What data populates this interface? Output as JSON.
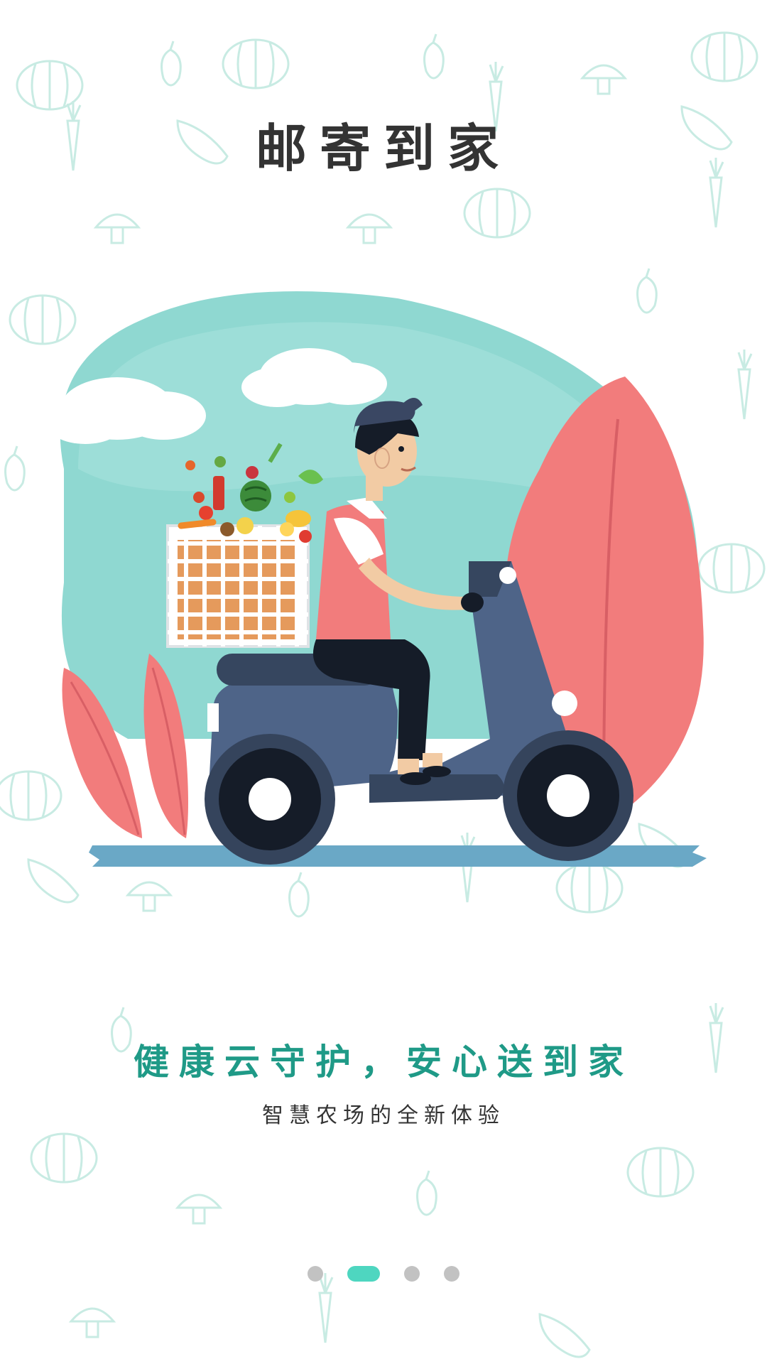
{
  "page": {
    "title": "邮寄到家",
    "slogan": "健康云守护，安心送到家",
    "subtitle": "智慧农场的全新体验"
  },
  "illustration": {
    "icon": "delivery-scooter-illustration"
  },
  "pager": {
    "total": 4,
    "active_index": 1
  },
  "colors": {
    "accent": "#4ed6c0",
    "slogan": "#1f9a87",
    "title": "#333333",
    "sky": "#8fd8d1",
    "plant": "#f27c7c",
    "scooter": "#4e6488",
    "road": "#6aa8c6",
    "doodle": "#cfeee7"
  }
}
